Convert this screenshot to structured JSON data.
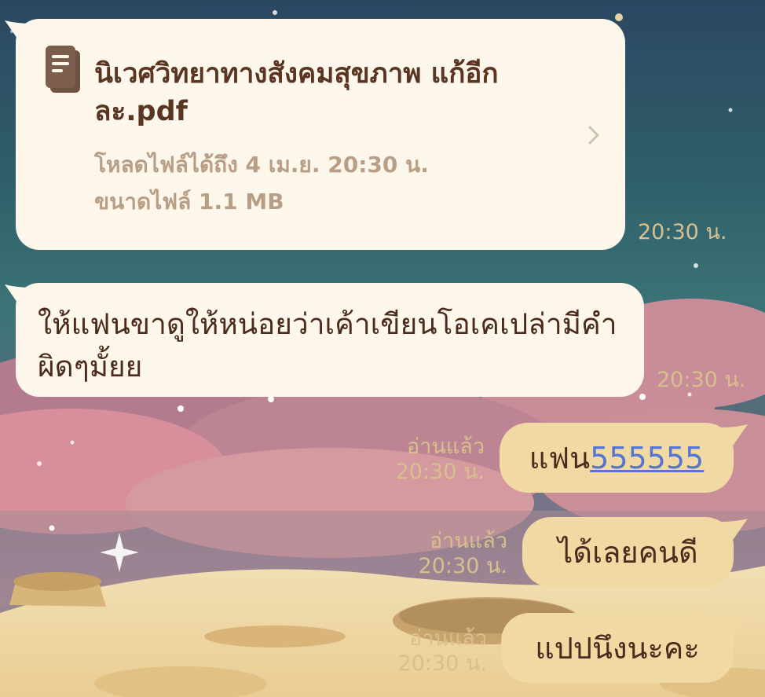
{
  "messages": {
    "file": {
      "title": "นิเวศวิทยาทางสังคมสุขภาพ แก้อีกละ.pdf",
      "expiry": "โหลดไฟล์ได้ถึง 4 เม.ย. 20:30 น.",
      "size": "ขนาดไฟล์ 1.1 MB",
      "time": "20:30 น."
    },
    "incoming_text": {
      "text": "ให้แฟนขาดูให้หน่อยว่าเค้าเขียนโอเคเปล่ามีคำผิดๆมั้ยย",
      "time": "20:30 น."
    },
    "outgoing": [
      {
        "text": "แฟน",
        "link": "555555",
        "read": "อ่านแล้ว",
        "time": "20:30 น."
      },
      {
        "text": "ได้เลยคนดี",
        "read": "อ่านแล้ว",
        "time": "20:30 น."
      },
      {
        "text": "แปปนึงนะคะ",
        "read": "อ่านแล้ว",
        "time": "20:30 น."
      }
    ]
  },
  "colors": {
    "incoming_bubble": "#fdf6ea",
    "outgoing_bubble": "#f1d9a3",
    "timestamp": "#d8c08c",
    "link": "#5574d6"
  },
  "icons": {
    "file": "document-icon",
    "open": "chevron-right-icon"
  }
}
